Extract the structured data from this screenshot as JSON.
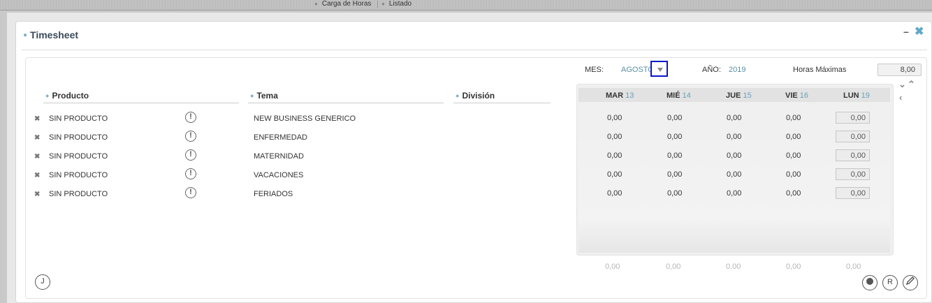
{
  "topbar": {
    "items": [
      "Carga de Horas",
      "Listado"
    ]
  },
  "window": {
    "title": "Timesheet",
    "minimize": "–",
    "close": "✖"
  },
  "filters": {
    "mes_label": "MES:",
    "mes_value": "AGOSTO",
    "anio_label": "AÑO:",
    "anio_value": "2019",
    "horas_max_label": "Horas Máximas",
    "horas_max_value": "8,00"
  },
  "columns": {
    "producto": "Producto",
    "tema": "Tema",
    "division": "División"
  },
  "days": [
    {
      "name": "MAR",
      "num": "13"
    },
    {
      "name": "MIÉ",
      "num": "14"
    },
    {
      "name": "JUE",
      "num": "15"
    },
    {
      "name": "VIE",
      "num": "16"
    },
    {
      "name": "LUN",
      "num": "19"
    }
  ],
  "rows": [
    {
      "remove": "✖",
      "producto": "SIN PRODUCTO",
      "warn": "!",
      "tema": "NEW BUSINESS GENERICO",
      "hours": [
        "0,00",
        "0,00",
        "0,00",
        "0,00",
        "0,00"
      ]
    },
    {
      "remove": "✖",
      "producto": "SIN PRODUCTO",
      "warn": "!",
      "tema": "ENFERMEDAD",
      "hours": [
        "0,00",
        "0,00",
        "0,00",
        "0,00",
        "0,00"
      ]
    },
    {
      "remove": "✖",
      "producto": "SIN PRODUCTO",
      "warn": "!",
      "tema": "MATERNIDAD",
      "hours": [
        "0,00",
        "0,00",
        "0,00",
        "0,00",
        "0,00"
      ]
    },
    {
      "remove": "✖",
      "producto": "SIN PRODUCTO",
      "warn": "!",
      "tema": "VACACIONES",
      "hours": [
        "0,00",
        "0,00",
        "0,00",
        "0,00",
        "0,00"
      ]
    },
    {
      "remove": "✖",
      "producto": "SIN PRODUCTO",
      "warn": "!",
      "tema": "FERIADOS",
      "hours": [
        "0,00",
        "0,00",
        "0,00",
        "0,00",
        "0,00"
      ]
    }
  ],
  "totals": [
    "0,00",
    "0,00",
    "0,00",
    "0,00",
    "0,00"
  ],
  "buttons": {
    "j_label": "J",
    "r_label": "R"
  },
  "icons": {
    "nav_up": "chevron-up-icon",
    "nav_down": "chevron-down-icon",
    "nav_prev": "chevron-left-icon",
    "edit": "pencil-icon",
    "record": "record-icon"
  },
  "colors": {
    "accent": "#5fa9c9",
    "highlight_border": "#0a17c9"
  }
}
